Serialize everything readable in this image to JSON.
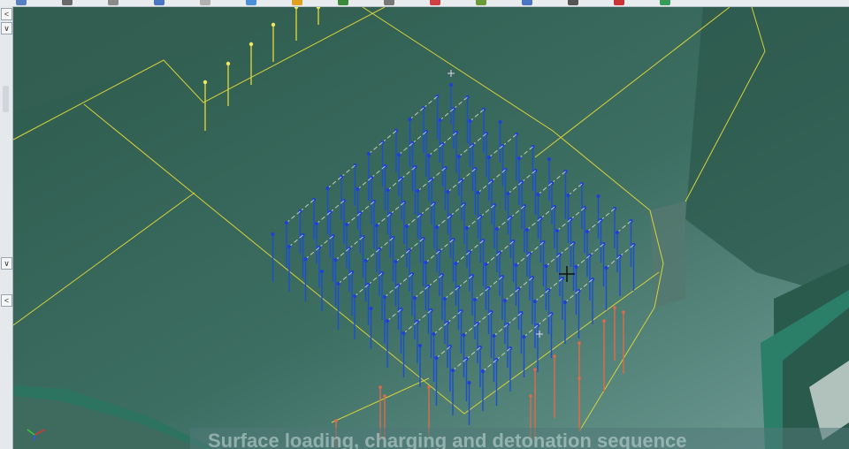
{
  "toolbar": {
    "icons": [
      "select-icon",
      "line-icon",
      "polygon-icon",
      "grid-icon",
      "table-icon",
      "view-icon",
      "arrow-icon",
      "layer-icon",
      "settings-icon",
      "blast-icon",
      "tree-icon",
      "camera-icon",
      "monitor-icon",
      "record-icon",
      "play-icon"
    ]
  },
  "left_panel": {
    "top_button": "<",
    "arrow_up": "∨",
    "arrow_down": "∨",
    "bottom_button": "<"
  },
  "viewport": {
    "caption": "Surface loading, charging and detonation sequence",
    "colors": {
      "terrain": "#2f5f52",
      "boundary": "#d8d23a",
      "hole_collar": "#1f3fd8",
      "hole_trace": "#1c4fd0",
      "hole_active": "#e06a4a",
      "row_link": "#e8e8c8"
    }
  }
}
